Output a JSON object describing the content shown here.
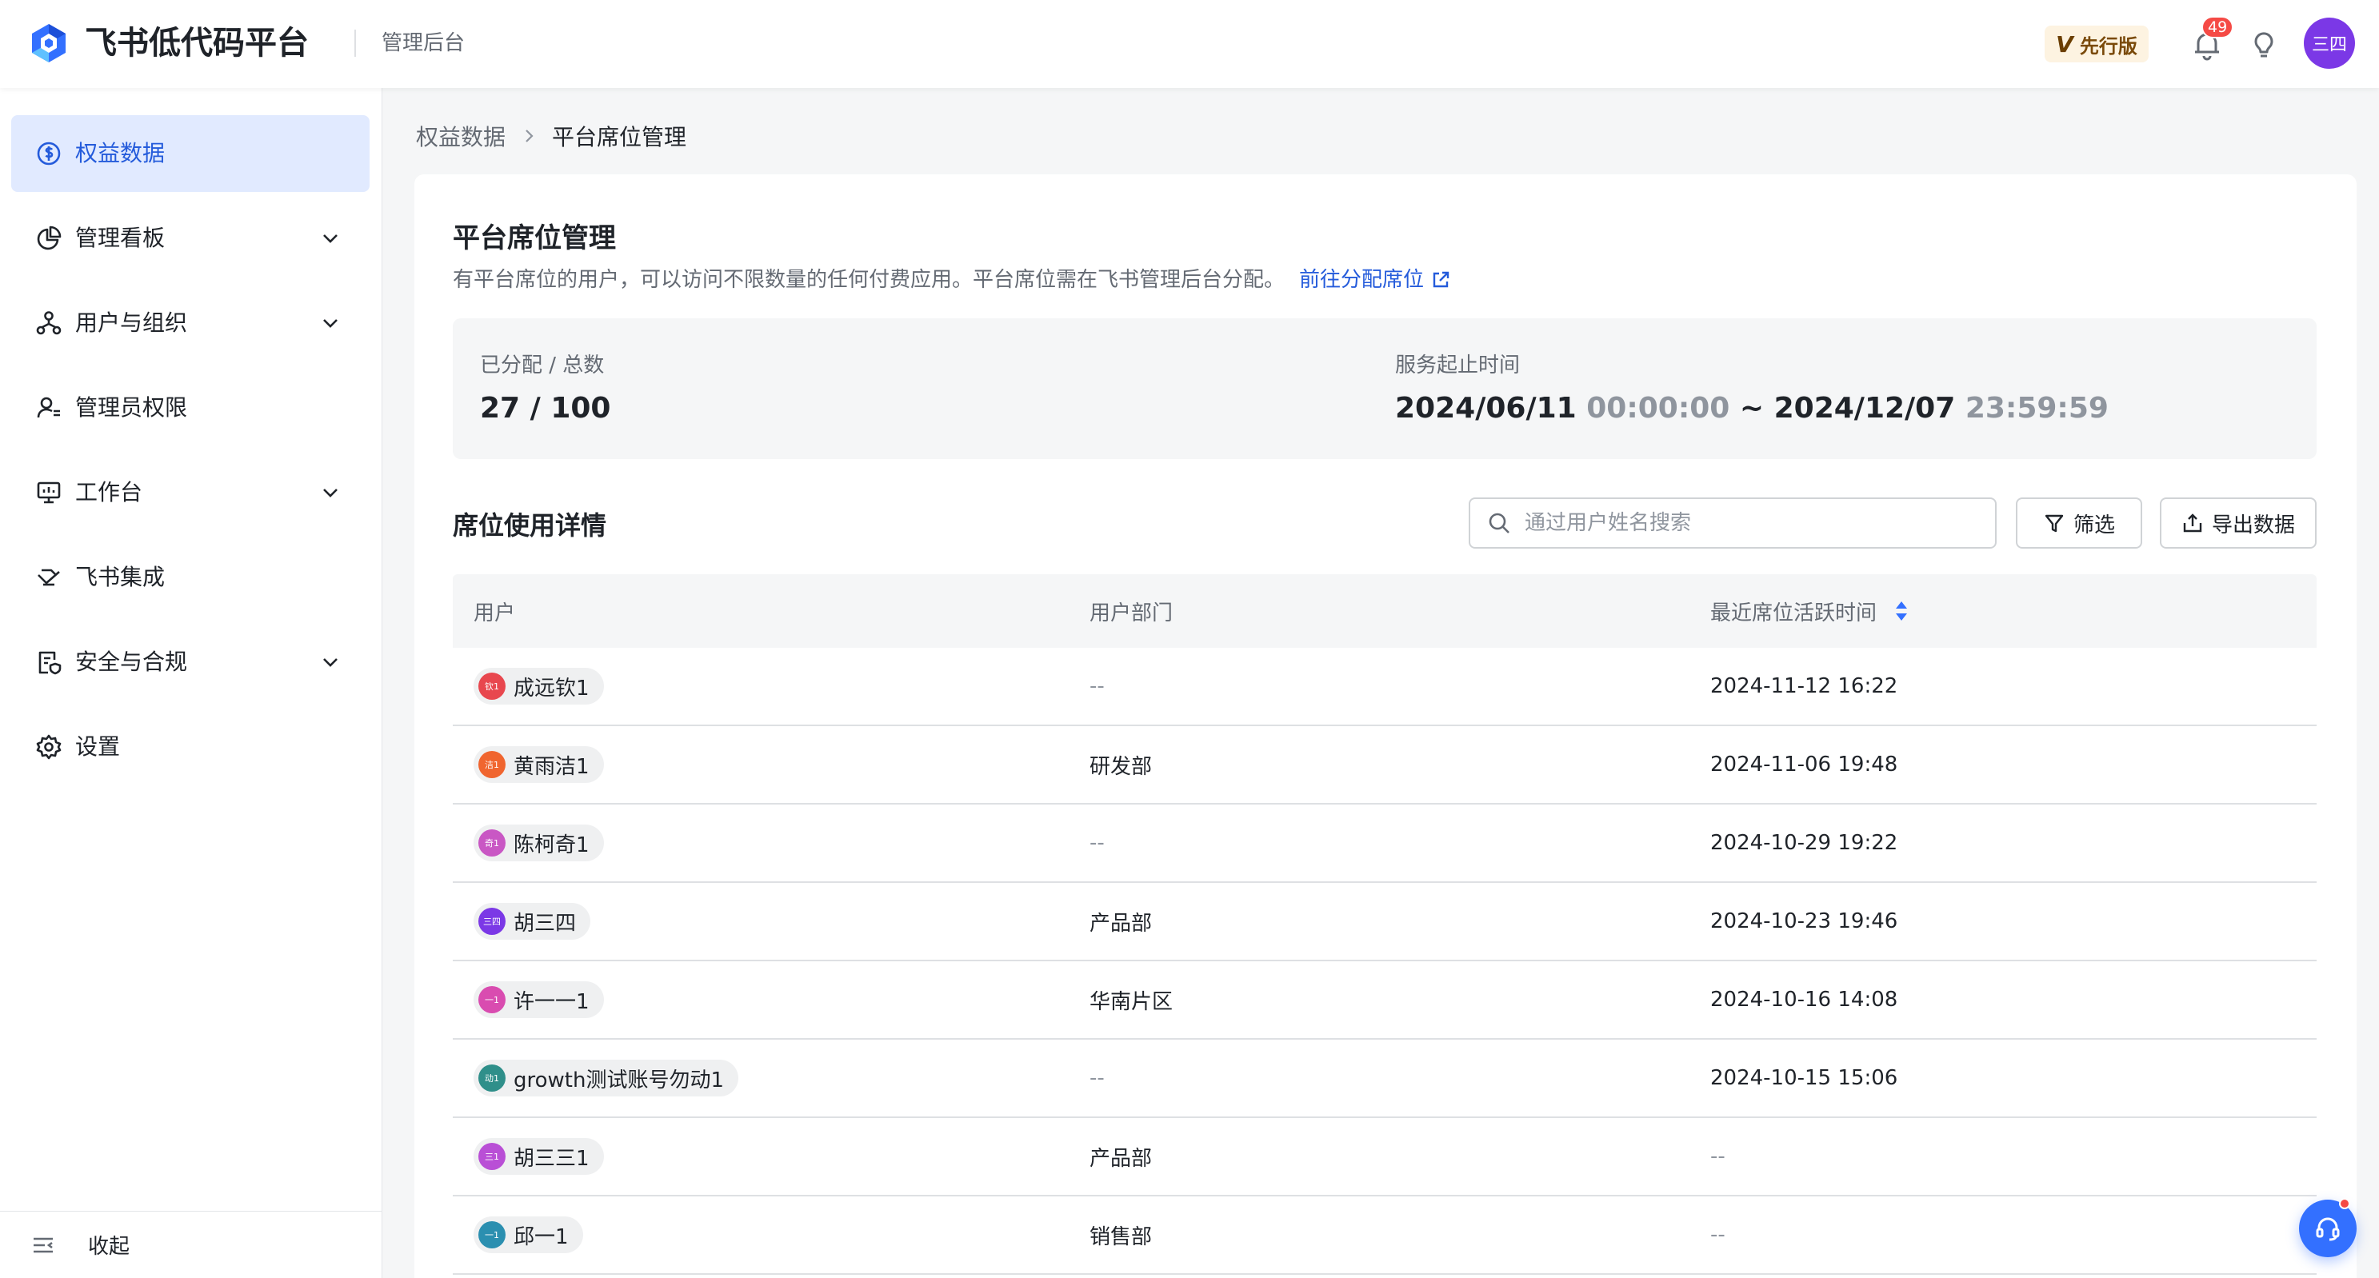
{
  "header": {
    "app_title": "飞书低代码平台",
    "app_subtitle": "管理后台",
    "edition_badge": "先行版",
    "edition_mark": "V",
    "notification_count": "49",
    "user_avatar_text": "三四"
  },
  "sidebar": {
    "items": [
      {
        "label": "权益数据",
        "icon": "dollar-circle-icon",
        "active": true,
        "expandable": false
      },
      {
        "label": "管理看板",
        "icon": "pie-chart-icon",
        "active": false,
        "expandable": true
      },
      {
        "label": "用户与组织",
        "icon": "org-tree-icon",
        "active": false,
        "expandable": true
      },
      {
        "label": "管理员权限",
        "icon": "user-admin-icon",
        "active": false,
        "expandable": false
      },
      {
        "label": "工作台",
        "icon": "monitor-icon",
        "active": false,
        "expandable": true
      },
      {
        "label": "飞书集成",
        "icon": "integration-icon",
        "active": false,
        "expandable": false
      },
      {
        "label": "安全与合规",
        "icon": "security-doc-icon",
        "active": false,
        "expandable": true
      },
      {
        "label": "设置",
        "icon": "gear-icon",
        "active": false,
        "expandable": false
      }
    ],
    "collapse_label": "收起"
  },
  "breadcrumb": {
    "parent": "权益数据",
    "current": "平台席位管理"
  },
  "page": {
    "title": "平台席位管理",
    "description": "有平台席位的用户，可以访问不限数量的任何付费应用。平台席位需在飞书管理后台分配。",
    "description_link": "前往分配席位",
    "stats": {
      "allocated_label": "已分配 / 总数",
      "allocated_value": "27 / 100",
      "service_label": "服务起止时间",
      "start_date": "2024/06/11",
      "start_time": "00:00:00",
      "range_sep": "~",
      "end_date": "2024/12/07",
      "end_time": "23:59:59"
    },
    "section_title": "席位使用详情",
    "search_placeholder": "通过用户姓名搜索",
    "filter_label": "筛选",
    "export_label": "导出数据"
  },
  "table": {
    "columns": [
      "用户",
      "用户部门",
      "最近席位活跃时间"
    ],
    "rows": [
      {
        "avatar": "钦1",
        "color": "#e8474e",
        "name": "成远钦1",
        "dept": "--",
        "time": "2024-11-12 16:22"
      },
      {
        "avatar": "洁1",
        "color": "#f0652f",
        "name": "黄雨洁1",
        "dept": "研发部",
        "time": "2024-11-06 19:48"
      },
      {
        "avatar": "奇1",
        "color": "#c957c4",
        "name": "陈柯奇1",
        "dept": "--",
        "time": "2024-10-29 19:22"
      },
      {
        "avatar": "三四",
        "color": "#7b38e6",
        "name": "胡三四",
        "dept": "产品部",
        "time": "2024-10-23 19:46"
      },
      {
        "avatar": "一1",
        "color": "#d94cb0",
        "name": "许一一1",
        "dept": "华南片区",
        "time": "2024-10-16 14:08"
      },
      {
        "avatar": "动1",
        "color": "#2f8f8a",
        "name": "growth测试账号勿动1",
        "dept": "--",
        "time": "2024-10-15 15:06"
      },
      {
        "avatar": "三1",
        "color": "#b94fd6",
        "name": "胡三三1",
        "dept": "产品部",
        "time": "--"
      },
      {
        "avatar": "一1",
        "color": "#2b8fb0",
        "name": "邱一1",
        "dept": "销售部",
        "time": "--"
      }
    ]
  }
}
